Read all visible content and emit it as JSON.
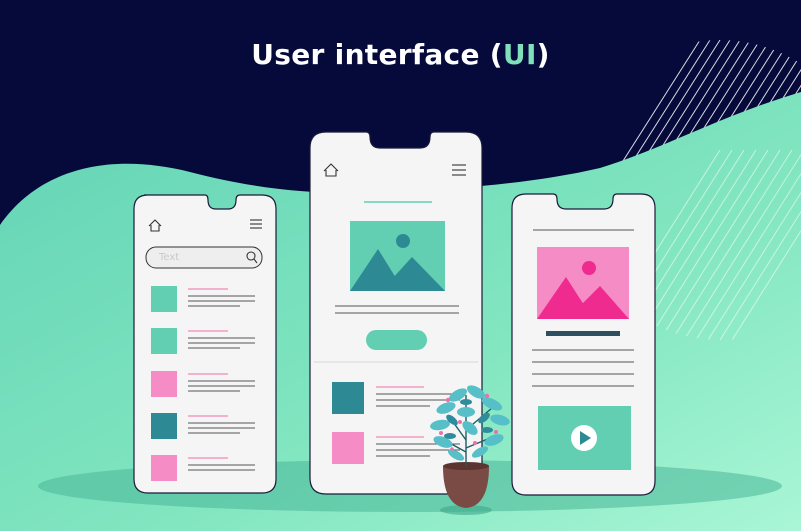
{
  "title": {
    "prefix": "User interface (",
    "highlight": "UI",
    "suffix": ")"
  },
  "search": {
    "placeholder": "Text"
  },
  "colors": {
    "background_navy": "#060a3b",
    "mint": "#62d3b5",
    "teal": "#2d8a94",
    "pink": "#f58cc6",
    "magenta": "#ef2b8f",
    "phone": "#f5f5f5"
  },
  "icons": [
    "home-icon",
    "menu-icon",
    "search-icon",
    "image-icon",
    "play-icon"
  ]
}
